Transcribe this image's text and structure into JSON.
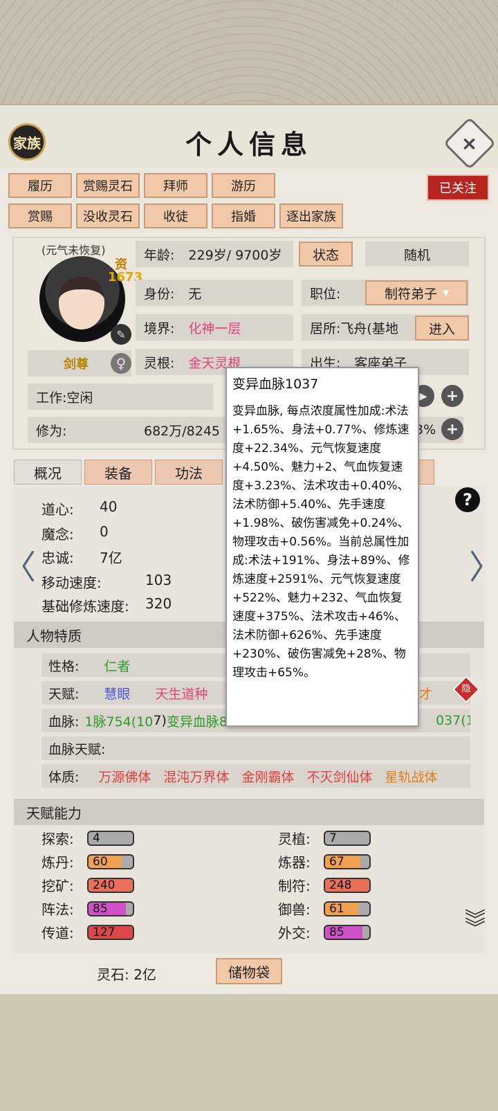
{
  "header": {
    "clan_label": "家族",
    "title": "个人信息",
    "close_symbol": "×"
  },
  "actions": {
    "row1": [
      "履历",
      "赏赐灵石",
      "拜师",
      "游历"
    ],
    "row2": [
      "赏赐",
      "没收灵石",
      "收徒",
      "指婚",
      "逐出家族"
    ],
    "follow": "已关注"
  },
  "profile": {
    "status_tag": "(元气未恢复)",
    "aptitude_label": "资",
    "aptitude_value": "1673",
    "title": "剑尊",
    "gender_symbol": "♀",
    "age_label": "年龄:",
    "age_value": "229岁/ 9700岁",
    "state_button": "状态",
    "random_button": "随机",
    "identity_label": "身份:",
    "identity_value": "无",
    "position_label": "职位:",
    "position_value": "制符弟子",
    "realm_label": "境界:",
    "realm_value": "化神一层",
    "residence_label": "居所:",
    "residence_value": "飞舟(基地",
    "enter_button": "进入",
    "root_label": "灵根:",
    "root_value": "金天灵根",
    "birth_label": "出生:",
    "birth_value": "客座弟子",
    "work_label": "工作:",
    "work_value": "空闲",
    "cultivation_label": "修为:",
    "cultivation_value": "682万/8245",
    "cultivation_pct": "3%"
  },
  "tabs": [
    "概况",
    "装备",
    "功法"
  ],
  "stats": {
    "daoxin_label": "道心:",
    "daoxin_value": "40",
    "monian_label": "魔念:",
    "monian_value": "0",
    "loyalty_label": "忠诚:",
    "loyalty_value": "7亿",
    "speed_label": "移动速度:",
    "speed_value": "103",
    "base_cult_label": "基础修炼速度:",
    "base_cult_value": "320"
  },
  "traits": {
    "section_title": "人物特质",
    "personality_label": "性格:",
    "personality_value": "仁者",
    "talent_label": "天赋:",
    "talent_1": "慧眼",
    "talent_2": "天生道种",
    "talent_3": "才",
    "hidden_badge": "隐",
    "bloodline_label": "血脉:",
    "bloodline_1": "1脉754(10",
    "bloodline_2": "7)",
    "bloodline_3": "变异血脉82",
    "bloodline_4": "037(1",
    "bloodline_talent_label": "血脉天赋:",
    "physique_label": "体质:",
    "physique_items": [
      "万源佛体",
      "混沌万界体",
      "金刚霸体",
      "不灭剑仙体",
      "星轨战体"
    ]
  },
  "abilities": {
    "section_title": "天赋能力",
    "items": [
      {
        "label": "探索:",
        "value": "4",
        "fill": 0.0,
        "color": "#9a9a9a"
      },
      {
        "label": "灵植:",
        "value": "7",
        "fill": 0.0,
        "color": "#9a9a9a"
      },
      {
        "label": "炼丹:",
        "value": "60",
        "fill": 0.75,
        "color": "#f0a050"
      },
      {
        "label": "炼器:",
        "value": "67",
        "fill": 0.8,
        "color": "#f0a050"
      },
      {
        "label": "挖矿:",
        "value": "240",
        "fill": 1.0,
        "color": "#e8705a"
      },
      {
        "label": "制符:",
        "value": "248",
        "fill": 1.0,
        "color": "#e8705a"
      },
      {
        "label": "阵法:",
        "value": "85",
        "fill": 0.85,
        "color": "#d050c8"
      },
      {
        "label": "御兽:",
        "value": "61",
        "fill": 0.75,
        "color": "#f0a050"
      },
      {
        "label": "传道:",
        "value": "127",
        "fill": 1.0,
        "color": "#d84848"
      },
      {
        "label": "外交:",
        "value": "85",
        "fill": 0.85,
        "color": "#d050c8"
      }
    ]
  },
  "footer": {
    "stone_label": "灵石: 2亿",
    "bag_button": "储物袋"
  },
  "tooltip": {
    "title": "变异血脉1037",
    "body": "变异血脉, 每点浓度属性加成:术法+1.65%、身法+0.77%、修炼速度+22.34%、元气恢复速度+4.50%、魅力+2、气血恢复速度+3.23%、法术攻击+0.40%、法术防御+5.40%、先手速度+1.98%、破伤害减免+0.24%、物理攻击+0.56%。当前总属性加成:术法+191%、身法+89%、修炼速度+2591%、元气恢复速度+522%、魅力+232、气血恢复速度+375%、法术攻击+46%、法术防御+626%、先手速度+230%、破伤害减免+28%、物理攻击+65%。"
  },
  "icons": {
    "help": "?",
    "plus": "+",
    "left_arrow": "〈",
    "right_arrow": "〉",
    "scroll_down": "⌄⌄⌄"
  }
}
